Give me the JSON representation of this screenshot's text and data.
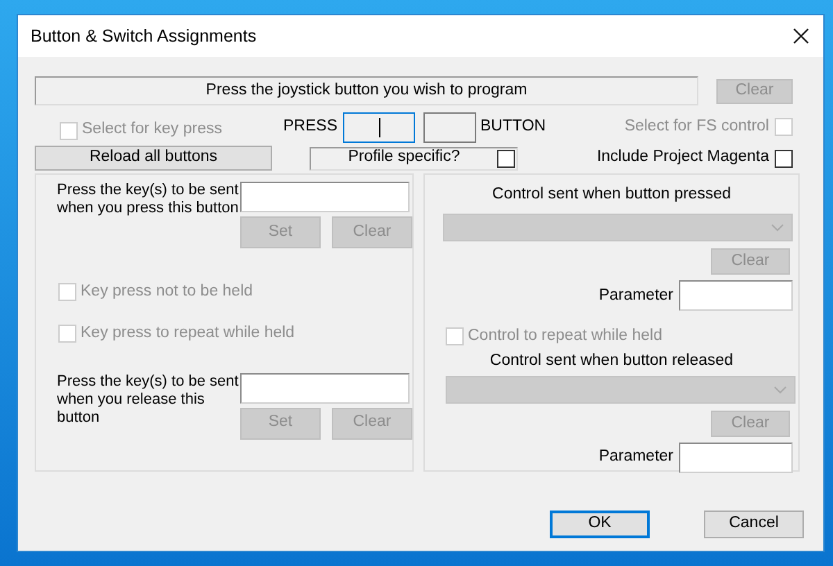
{
  "window": {
    "title": "Button & Switch Assignments"
  },
  "prompt": "Press the joystick button you wish to program",
  "prompt_clear": {
    "label": "Clear",
    "disabled": true
  },
  "select_key_press": {
    "label": "Select for key press",
    "checked": false,
    "disabled": true
  },
  "press_label": "PRESS",
  "press_fields": [
    {
      "focused": true
    },
    {
      "focused": false
    }
  ],
  "button_label": "BUTTON",
  "select_fs_control": {
    "label": "Select for FS control",
    "checked": false,
    "disabled": true
  },
  "reload_button": {
    "label": "Reload all buttons",
    "disabled": false
  },
  "profile_specific": {
    "label": "Profile specific?",
    "checked": false
  },
  "include_project_magenta": {
    "label": "Include Project Magenta",
    "checked": false
  },
  "key_panel": {
    "press": {
      "instruction": "Press the key(s) to be sent when you press this button",
      "set": {
        "label": "Set",
        "disabled": true
      },
      "clear": {
        "label": "Clear",
        "disabled": true
      }
    },
    "options": [
      {
        "label": "Key press not to be held",
        "checked": false,
        "disabled": true
      },
      {
        "label": "Key press to repeat while held",
        "checked": false,
        "disabled": true
      }
    ],
    "release": {
      "instruction": "Press the key(s) to be sent when you release this button",
      "set": {
        "label": "Set",
        "disabled": true
      },
      "clear": {
        "label": "Clear",
        "disabled": true
      }
    }
  },
  "control_panel": {
    "pressed": {
      "title": "Control sent when button pressed",
      "clear": {
        "label": "Clear",
        "disabled": true
      },
      "parameter_label": "Parameter"
    },
    "repeat": {
      "label": "Control to repeat while held",
      "checked": false,
      "disabled": true
    },
    "released": {
      "title": "Control sent when button released",
      "clear": {
        "label": "Clear",
        "disabled": true
      },
      "parameter_label": "Parameter"
    }
  },
  "buttons": [
    {
      "label": "OK",
      "default": true
    },
    {
      "label": "Cancel",
      "default": false
    }
  ]
}
